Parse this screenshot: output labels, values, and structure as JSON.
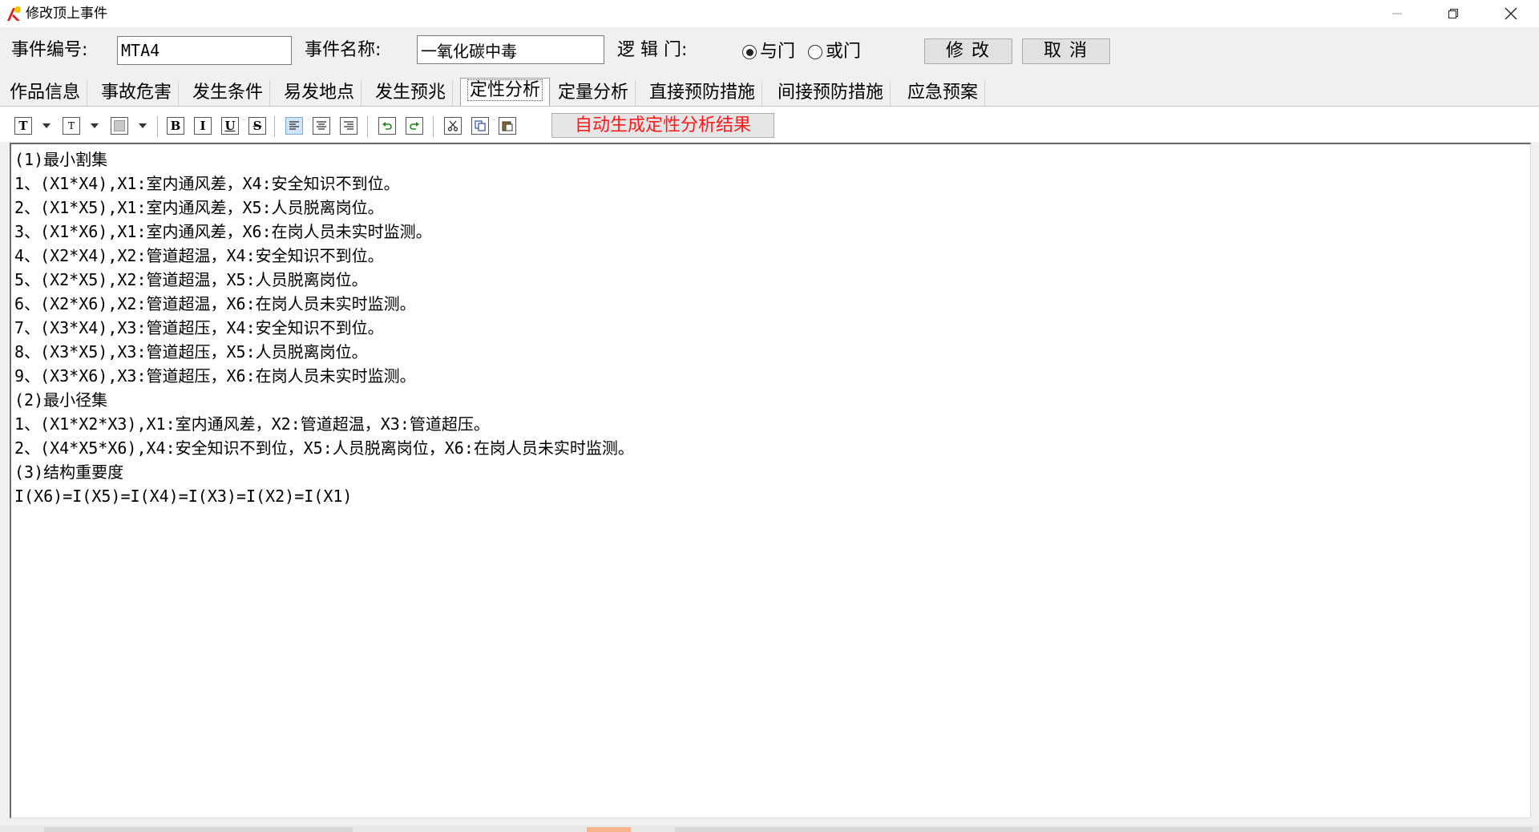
{
  "window": {
    "title": "修改顶上事件",
    "controls": {
      "minimize": "minimize-icon",
      "maximize": "restore-icon",
      "close": "close-icon"
    }
  },
  "header": {
    "event_id_label": "事件编号:",
    "event_id_value": "MTA4",
    "event_name_label": "事件名称:",
    "event_name_value": "一氧化碳中毒",
    "logic_gate_label": "逻 辑 门:",
    "gate_options": [
      {
        "label": "与门",
        "selected": true
      },
      {
        "label": "或门",
        "selected": false
      }
    ],
    "modify_button": "修改",
    "cancel_button": "取消"
  },
  "tabs": [
    {
      "label": "作品信息",
      "active": false
    },
    {
      "label": "事故危害",
      "active": false
    },
    {
      "label": "发生条件",
      "active": false
    },
    {
      "label": "易发地点",
      "active": false
    },
    {
      "label": "发生预兆",
      "active": false
    },
    {
      "label": "定性分析",
      "active": true
    },
    {
      "label": "定量分析",
      "active": false
    },
    {
      "label": "直接预防措施",
      "active": false
    },
    {
      "label": "间接预防措施",
      "active": false
    },
    {
      "label": "应急预案",
      "active": false
    }
  ],
  "toolbar": {
    "icons": [
      "font-icon",
      "font-size-icon",
      "background-color-icon",
      "bold-icon",
      "italic-icon",
      "underline-icon",
      "strikethrough-icon",
      "align-left-icon",
      "align-center-icon",
      "align-right-icon",
      "undo-icon",
      "redo-icon",
      "cut-icon",
      "copy-icon",
      "paste-icon"
    ],
    "glyphs": {
      "font": "T",
      "bold": "B",
      "italic": "I",
      "underline": "U",
      "strike": "S"
    },
    "auto_generate_button": "自动生成定性分析结果",
    "auto_generate_color": "#ff1a1a"
  },
  "editor": {
    "lines": [
      "(1)最小割集",
      "1、(X1*X4),X1:室内通风差，X4:安全知识不到位。",
      "2、(X1*X5),X1:室内通风差，X5:人员脱离岗位。",
      "3、(X1*X6),X1:室内通风差，X6:在岗人员未实时监测。",
      "4、(X2*X4),X2:管道超温，X4:安全知识不到位。",
      "5、(X2*X5),X2:管道超温，X5:人员脱离岗位。",
      "6、(X2*X6),X2:管道超温，X6:在岗人员未实时监测。",
      "7、(X3*X4),X3:管道超压，X4:安全知识不到位。",
      "8、(X3*X5),X3:管道超压，X5:人员脱离岗位。",
      "9、(X3*X6),X3:管道超压，X6:在岗人员未实时监测。",
      "(2)最小径集",
      "1、(X1*X2*X3),X1:室内通风差，X2:管道超温，X3:管道超压。",
      "2、(X4*X5*X6),X4:安全知识不到位，X5:人员脱离岗位，X6:在岗人员未实时监测。",
      "(3)结构重要度",
      "I(X6)=I(X5)=I(X4)=I(X3)=I(X2)=I(X1)"
    ]
  }
}
